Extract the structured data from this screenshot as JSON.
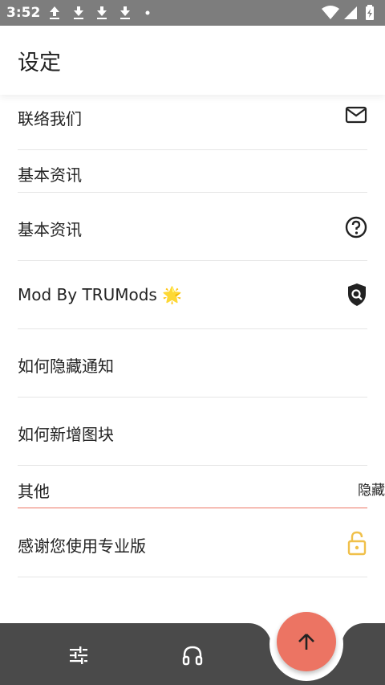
{
  "status_bar": {
    "time": "3:52"
  },
  "app_bar": {
    "title": "设定"
  },
  "rows": {
    "contact": "联络我们",
    "section_basic": "基本资讯",
    "basic_info": "基本资讯",
    "mod_by": "Mod By TRUMods 🌟",
    "hide_notification": "如何隐藏通知",
    "add_tile": "如何新增图块",
    "section_other": "其他",
    "hide": "隐藏",
    "thanks_pro": "感谢您使用专业版"
  },
  "colors": {
    "accent": "#ec7463",
    "section_label": "#e8735f",
    "lock": "#f0c04a",
    "nav_bar": "#4a4a4a"
  },
  "icons": {
    "contact": "mail-icon",
    "basic_info": "help-circle-icon",
    "mod_by": "shield-search-icon",
    "thanks_pro": "lock-open-icon",
    "nav_settings": "tune-sliders-icon",
    "nav_audio": "headphones-icon",
    "fab": "arrow-up-icon"
  }
}
